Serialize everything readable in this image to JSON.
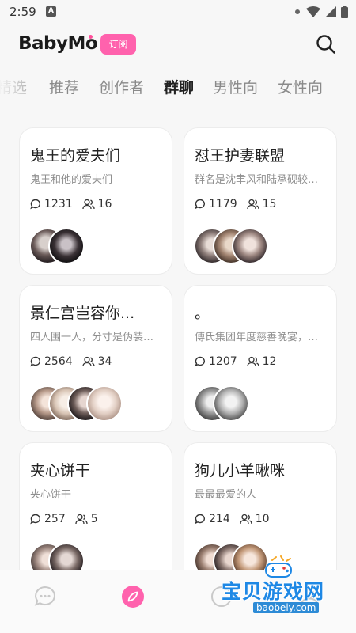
{
  "status_bar": {
    "time": "2:59",
    "app_icon_letter": "A"
  },
  "header": {
    "logo_text": "BabyMo",
    "subscribe_label": "订阅",
    "brand_color": "#ff62ad"
  },
  "tabs": [
    {
      "label": "精选",
      "active": false
    },
    {
      "label": "推荐",
      "active": false
    },
    {
      "label": "创作者",
      "active": false
    },
    {
      "label": "群聊",
      "active": true
    },
    {
      "label": "男性向",
      "active": false
    },
    {
      "label": "女性向",
      "active": false
    }
  ],
  "cards": [
    {
      "title": "鬼王的爱夫们",
      "description": "鬼王和他的爱夫们",
      "messages": "1231",
      "members": "16",
      "avatars": 2
    },
    {
      "title": "怼王护妻联盟",
      "description": "群名是沈聿风和陆承砚较…",
      "messages": "1179",
      "members": "15",
      "avatars": 3
    },
    {
      "title": "景仁宫岂容你...",
      "description": "四人围一人，分寸是伪装…",
      "messages": "2564",
      "members": "34",
      "avatars": 4
    },
    {
      "title": "。",
      "description": "傅氏集团年度慈善晚宴，…",
      "messages": "1207",
      "members": "12",
      "avatars": 2
    },
    {
      "title": "夹心饼干",
      "description": "夹心饼干",
      "messages": "257",
      "members": "5",
      "avatars": 2
    },
    {
      "title": "狗儿小羊啾咪",
      "description": "最最最爱的人",
      "messages": "214",
      "members": "10",
      "avatars": 3
    }
  ],
  "bottom_nav": [
    {
      "icon": "chat-bubble-icon",
      "active": false
    },
    {
      "icon": "compass-icon",
      "active": true
    },
    {
      "icon": "create-icon",
      "active": false
    },
    {
      "icon": "profile-icon",
      "active": false
    }
  ],
  "watermark": {
    "text": "宝贝游戏网",
    "url": "baobeiy.com"
  }
}
